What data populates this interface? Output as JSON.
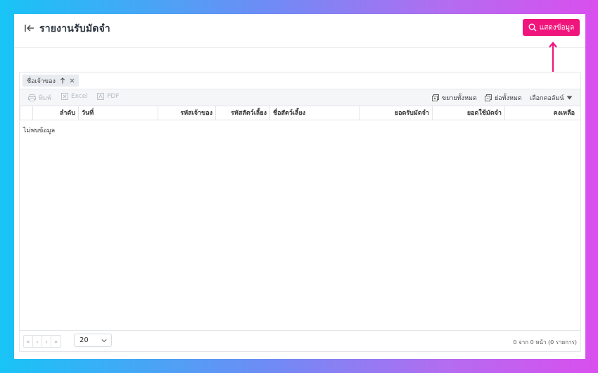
{
  "header": {
    "title": "รายงานรับมัดจำ",
    "show_button_label": "แสดงข้อมูล"
  },
  "colors": {
    "accent": "#f0157c",
    "background_gradient_start": "#18c4f6",
    "background_gradient_end": "#d94fee"
  },
  "group_bar": {
    "chip_label": "ชื่อเจ้าของ"
  },
  "toolbar": {
    "print_label": "พิมพ์",
    "excel_label": "Excel",
    "pdf_label": "PDF",
    "expand_all_label": "ขยายทั้งหมด",
    "collapse_all_label": "ย่อทั้งหมด",
    "choose_columns_label": "เลือกคอลัมน์"
  },
  "table": {
    "columns": [
      "ลำดับ",
      "วันที่",
      "รหัสเจ้าของ",
      "รหัสสัตว์เลี้ยง",
      "ชื่อสัตว์เลี้ยง",
      "ยอดรับมัดจำ",
      "ยอดใช้มัดจำ",
      "คงเหลือ"
    ],
    "empty_text": "ไม่พบข้อมูล"
  },
  "footer": {
    "pager_buttons": [
      "«",
      "‹",
      "›",
      "»"
    ],
    "page_size": "20",
    "page_info": "0 จาก 0 หน้า (0 รายการ)"
  }
}
